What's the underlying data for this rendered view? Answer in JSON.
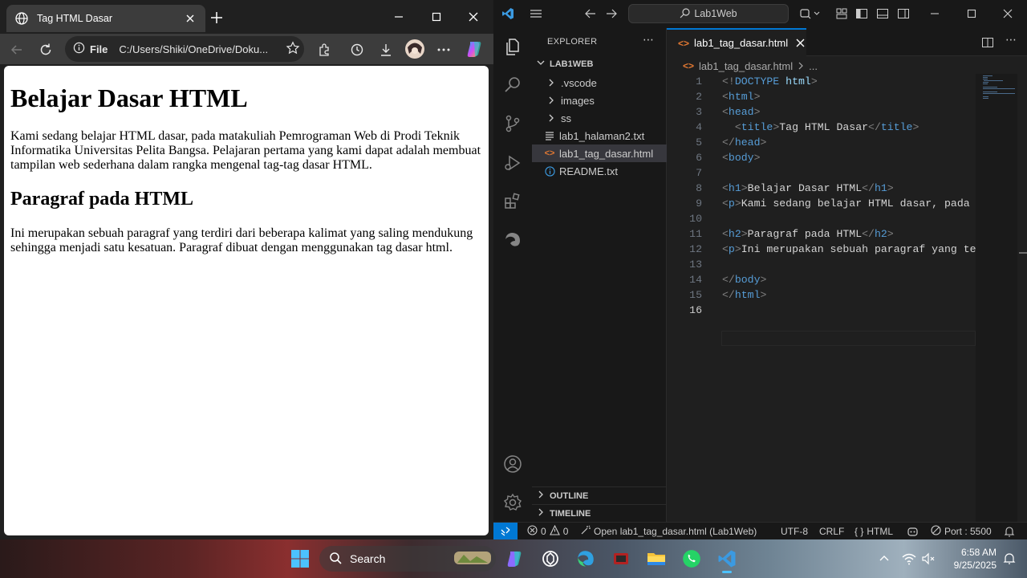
{
  "browser": {
    "tab_title": "Tag HTML Dasar",
    "address_label": "File",
    "address_url": "C:/Users/Shiki/OneDrive/Doku...",
    "page": {
      "h1": "Belajar Dasar HTML",
      "p1": "Kami sedang belajar HTML dasar, pada matakuliah Pemrograman Web di Prodi Teknik Informatika Universitas Pelita Bangsa. Pelajaran pertama yang kami dapat adalah membuat tampilan web sederhana dalam rangka mengenal tag-tag dasar HTML.",
      "h2": "Paragraf pada HTML",
      "p2": "Ini merupakan sebuah paragraf yang terdiri dari beberapa kalimat yang saling mendukung sehingga menjadi satu kesatuan. Paragraf dibuat dengan menggunakan tag dasar html."
    }
  },
  "vscode": {
    "search_label": "Lab1Web",
    "explorer_title": "EXPLORER",
    "project": "LAB1WEB",
    "tree": [
      {
        "label": ".vscode",
        "kind": "folder"
      },
      {
        "label": "images",
        "kind": "folder"
      },
      {
        "label": "ss",
        "kind": "folder"
      },
      {
        "label": "lab1_halaman2.txt",
        "kind": "txt"
      },
      {
        "label": "lab1_tag_dasar.html",
        "kind": "html"
      },
      {
        "label": "README.txt",
        "kind": "info"
      }
    ],
    "outline": "OUTLINE",
    "timeline": "TIMELINE",
    "tab_label": "lab1_tag_dasar.html",
    "breadcrumb_file": "lab1_tag_dasar.html",
    "breadcrumb_more": "...",
    "line_numbers": [
      "1",
      "2",
      "3",
      "4",
      "5",
      "6",
      "7",
      "8",
      "9",
      "10",
      "11",
      "12",
      "13",
      "14",
      "15",
      "16"
    ],
    "status": {
      "errors": "0",
      "warnings": "0",
      "open_file": "Open lab1_tag_dasar.html (Lab1Web)",
      "encoding": "UTF-8",
      "eol": "CRLF",
      "language": "HTML",
      "port": "Port : 5500"
    }
  },
  "taskbar": {
    "search_label": "Search",
    "time": "6:58 AM",
    "date": "9/25/2025"
  }
}
